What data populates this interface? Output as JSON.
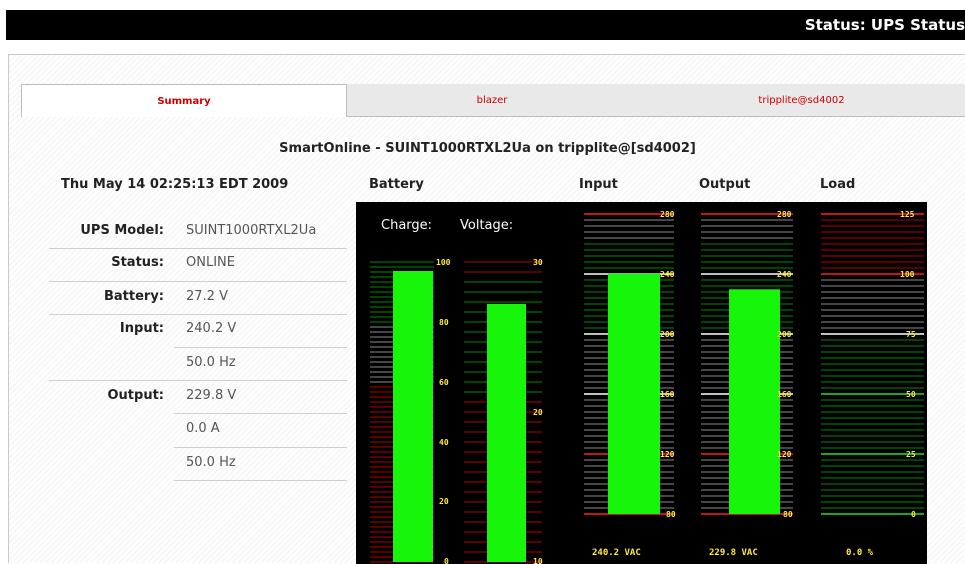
{
  "page_title": "Status: UPS Status",
  "tabs": [
    {
      "label": "Summary",
      "active": true
    },
    {
      "label": "blazer",
      "active": false
    },
    {
      "label": "tripplite@sd4002",
      "active": false
    }
  ],
  "heading": "SmartOnline - SUINT1000RTXL2Ua on tripplite@[sd4002]",
  "datetime": "Thu May 14 02:25:13 EDT 2009",
  "column_headers": {
    "battery": "Battery",
    "input": "Input",
    "output": "Output",
    "load": "Load"
  },
  "details": {
    "model_label": "UPS Model:",
    "model_value": "SUINT1000RTXL2Ua",
    "status_label": "Status:",
    "status_value": "ONLINE",
    "battery_label": "Battery:",
    "battery_value": "27.2 V",
    "input_label": "Input:",
    "input_voltage": "240.2 V",
    "input_frequency": "50.0 Hz",
    "output_label": "Output:",
    "output_voltage": "229.8 V",
    "output_current": "0.0 A",
    "output_frequency": "50.0 Hz"
  },
  "gauges": {
    "charge": {
      "header": "Charge:",
      "value": 97,
      "min": 0,
      "max": 100,
      "ticks": [
        "100",
        "80",
        "60",
        "40",
        "20",
        "0"
      ],
      "zones": {
        "good_from": 80,
        "warn_from": 60
      }
    },
    "battery_voltage": {
      "header": "Voltage:",
      "value": 27.2,
      "min": 10,
      "max": 30,
      "ticks": [
        "30",
        "20",
        "10"
      ]
    },
    "input": {
      "value": 240.2,
      "min": 80,
      "max": 280,
      "ticks": [
        "280",
        "240",
        "200",
        "160",
        "120",
        "80"
      ],
      "readout": "240.2 VAC",
      "green_range": [
        200,
        260
      ]
    },
    "output": {
      "value": 229.8,
      "min": 80,
      "max": 280,
      "ticks": [
        "280",
        "240",
        "200",
        "160",
        "120",
        "80"
      ],
      "readout": "229.8 VAC",
      "green_range": [
        200,
        260
      ]
    },
    "load": {
      "value": 0.0,
      "min": 0,
      "max": 125,
      "ticks": [
        "125",
        "100",
        "75",
        "50",
        "25",
        "0"
      ],
      "readout": "0.0 %"
    }
  },
  "colors": {
    "bar": "#16f50a",
    "red_line": "#b40000",
    "green_line": "#008c00",
    "gray_line": "#8c8c8c",
    "label": "#ffeb3b"
  }
}
